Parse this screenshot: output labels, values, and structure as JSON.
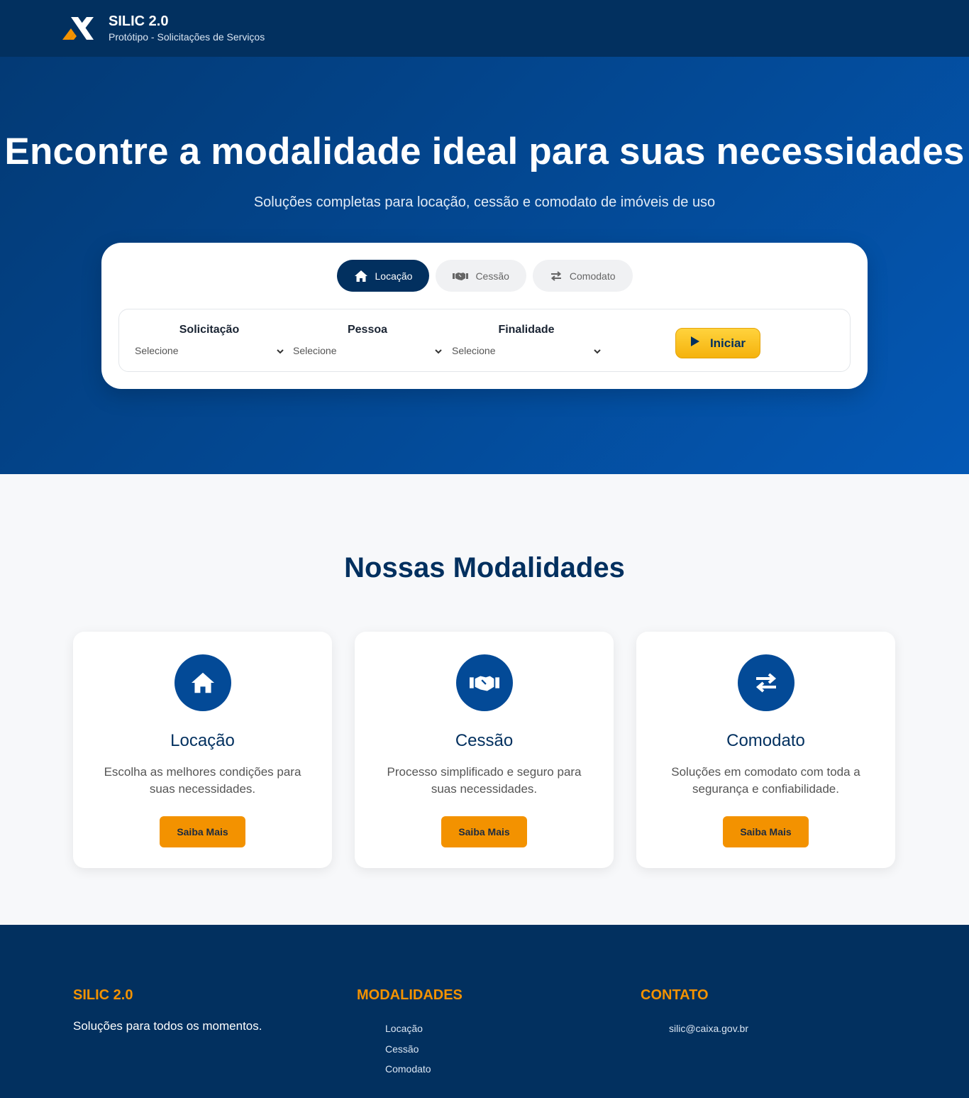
{
  "header": {
    "title": "SILIC 2.0",
    "subtitle": "Protótipo - Solicitações de Serviços"
  },
  "hero": {
    "title": "Encontre a modalidade ideal para suas necessidades",
    "subtitle": "Soluções completas para locação, cessão e comodato de imóveis de uso"
  },
  "search": {
    "tabs": [
      {
        "label": "Locação",
        "icon": "home-icon",
        "active": true
      },
      {
        "label": "Cessão",
        "icon": "handshake-icon",
        "active": false
      },
      {
        "label": "Comodato",
        "icon": "exchange-arrows-icon",
        "active": false
      }
    ],
    "fields": [
      {
        "label": "Solicitação",
        "value": "Selecione"
      },
      {
        "label": "Pessoa",
        "value": "Selecione"
      },
      {
        "label": "Finalidade",
        "value": "Selecione"
      }
    ],
    "start_label": "Iniciar"
  },
  "modalidades": {
    "title": "Nossas Modalidades",
    "cards": [
      {
        "title": "Locação",
        "text": "Escolha as melhores condições para suas necessidades.",
        "button": "Saiba Mais",
        "icon": "home-icon"
      },
      {
        "title": "Cessão",
        "text": "Processo simplificado e seguro para suas necessidades.",
        "button": "Saiba Mais",
        "icon": "handshake-icon"
      },
      {
        "title": "Comodato",
        "text": "Soluções em comodato com toda a segurança e confiabilidade.",
        "button": "Saiba Mais",
        "icon": "exchange-arrows-icon"
      }
    ]
  },
  "footer": {
    "brand_title": "SILIC 2.0",
    "brand_text": "Soluções para todos os momentos.",
    "modalidades_title": "MODALIDADES",
    "links": [
      "Locação",
      "Cessão",
      "Comodato"
    ],
    "contato_title": "CONTATO",
    "email": "silic@caixa.gov.br"
  },
  "colors": {
    "primary": "#02305f",
    "accent": "#f39200",
    "start_button": "#f5b20c"
  }
}
